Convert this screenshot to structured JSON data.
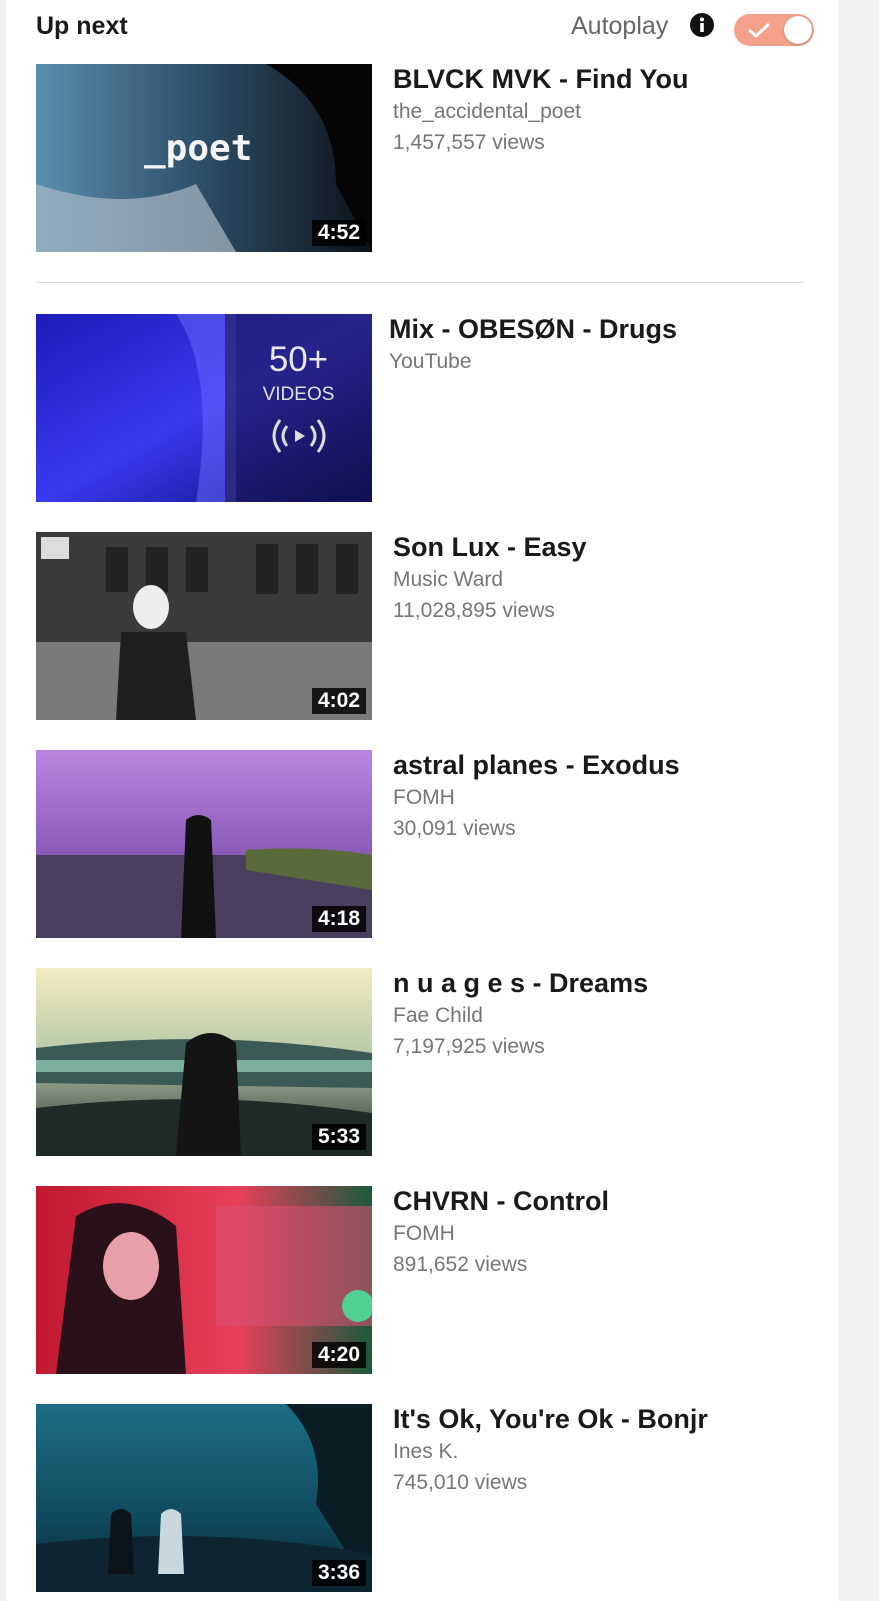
{
  "header": {
    "up_next_label": "Up next",
    "autoplay_label": "Autoplay",
    "autoplay_enabled": true,
    "toggle_color": "#f4a08a"
  },
  "videos": [
    {
      "title": "BLVCK MVK - Find You",
      "channel": "the_accidental_poet",
      "views": "1,457,557 views",
      "duration": "4:52",
      "thumb_text": "_poet"
    },
    {
      "title": "Mix - OBESØN - Drugs",
      "channel": "YouTube",
      "playlist_count": "50+",
      "playlist_label": "VIDEOS"
    },
    {
      "title": "Son Lux - Easy",
      "channel": "Music Ward",
      "views": "11,028,895 views",
      "duration": "4:02"
    },
    {
      "title": "astral planes - Exodus",
      "channel": "FOMH",
      "views": "30,091 views",
      "duration": "4:18"
    },
    {
      "title": "n u a g e s - Dreams",
      "channel": "Fae Child",
      "views": "7,197,925 views",
      "duration": "5:33"
    },
    {
      "title": "CHVRN - Control",
      "channel": "FOMH",
      "views": "891,652 views",
      "duration": "4:20"
    },
    {
      "title": "It's Ok, You're Ok - Bonjr",
      "channel": "Ines K.",
      "views": "745,010 views",
      "duration": "3:36"
    }
  ]
}
